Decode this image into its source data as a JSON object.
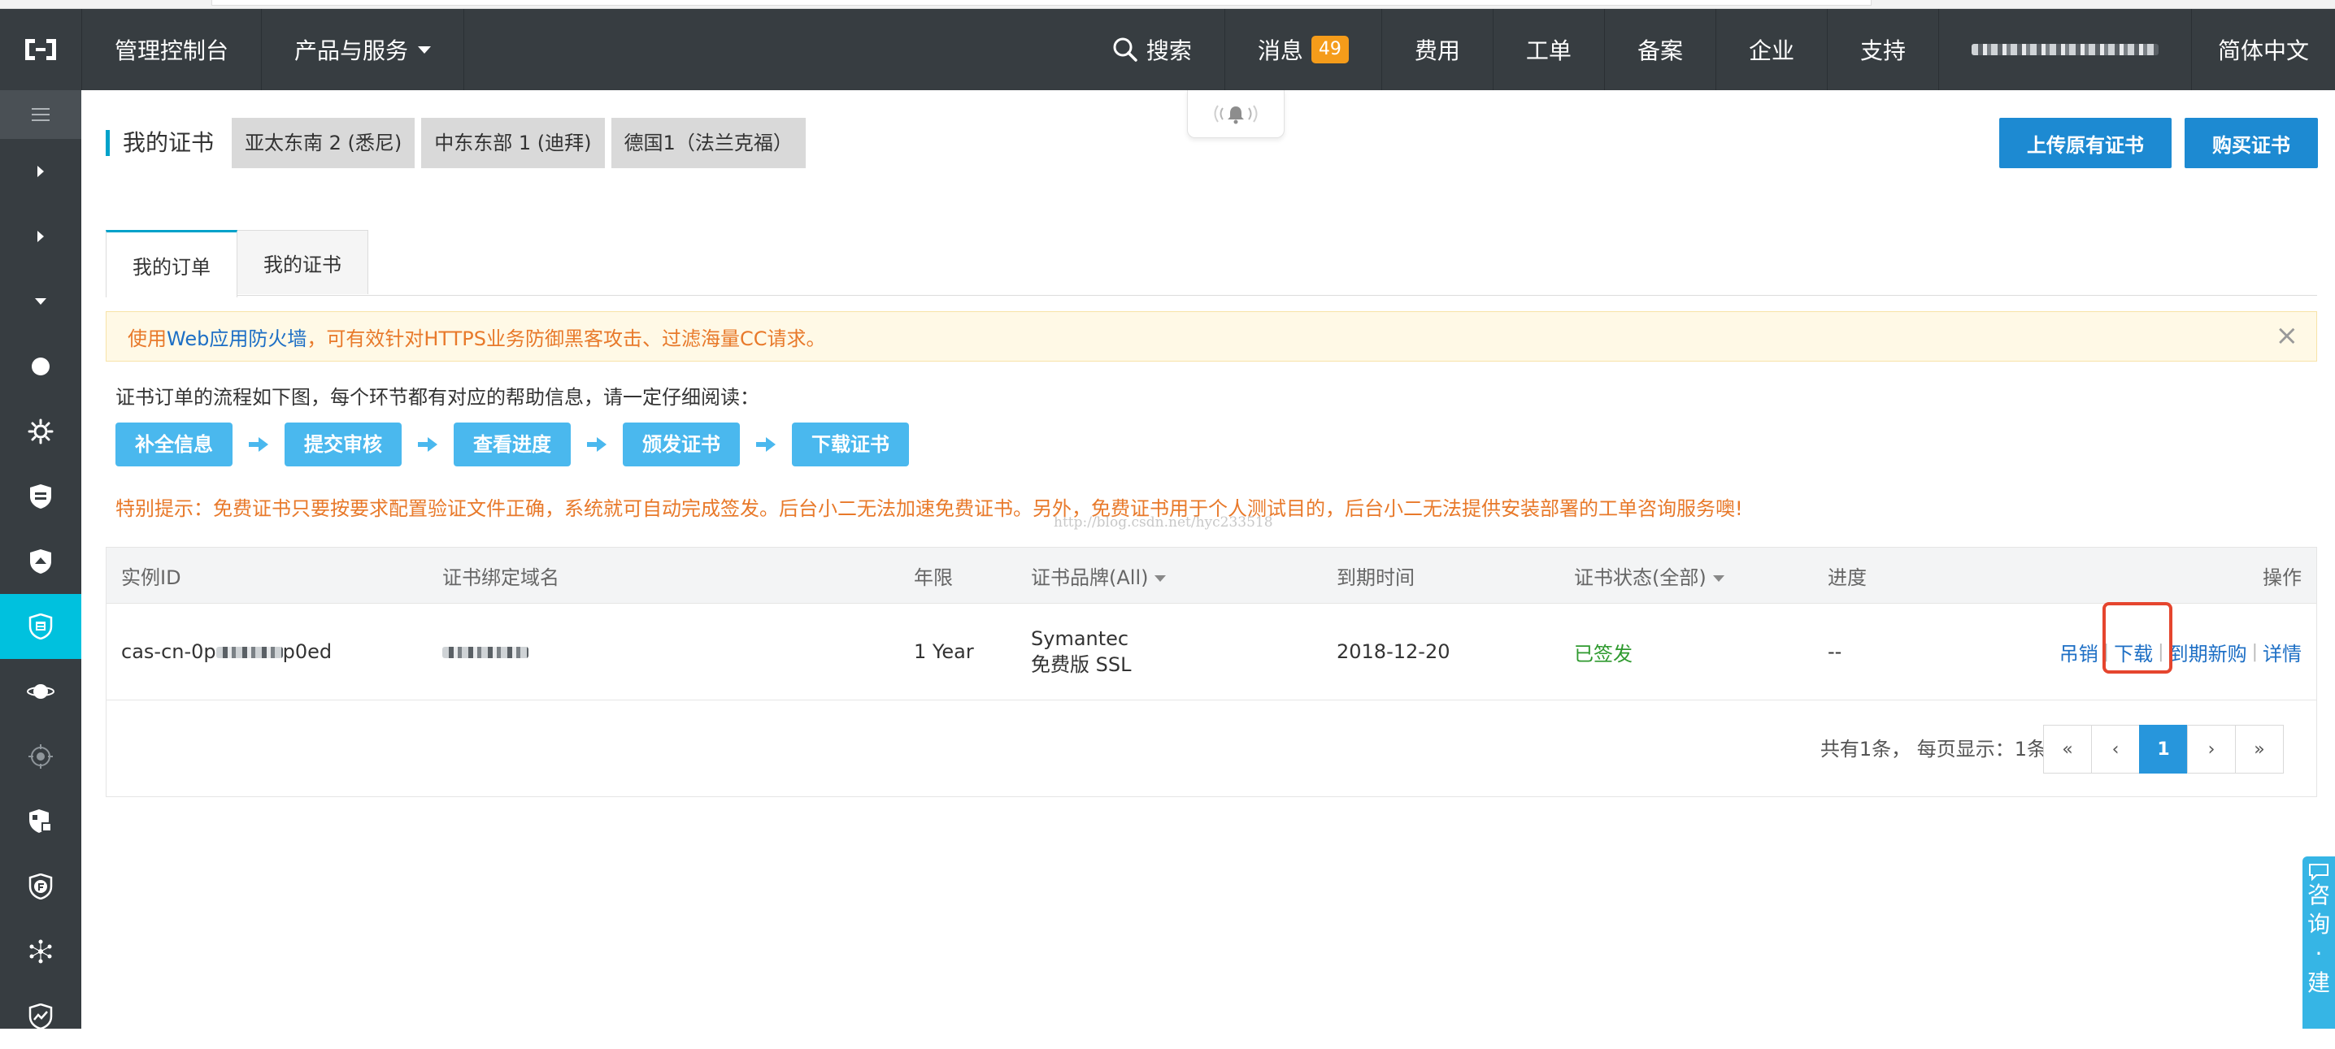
{
  "topnav": {
    "console": "管理控制台",
    "products": "产品与服务",
    "search": "搜索",
    "messages": "消息",
    "messages_count": "49",
    "billing": "费用",
    "ticket": "工单",
    "beian": "备案",
    "enterprise": "企业",
    "support": "支持",
    "language": "简体中文"
  },
  "sidebar": {
    "icons": [
      "menu-icon",
      "chevron-right-icon",
      "chevron-right-icon",
      "chevron-down-icon",
      "dot-icon",
      "gear-icon",
      "shield-icon",
      "shield-icon",
      "certificate-icon",
      "planet-icon",
      "target-icon",
      "shield-lock-icon",
      "shield-f-icon",
      "network-icon",
      "chart-shield-icon"
    ],
    "active_index": 8
  },
  "header": {
    "title": "我的证书",
    "regions": [
      "亚太东南 2 (悉尼)",
      "中东东部 1 (迪拜)",
      "德国1（法兰克福）"
    ],
    "upload_btn": "上传原有证书",
    "buy_btn": "购买证书"
  },
  "tabs": [
    "我的订单",
    "我的证书"
  ],
  "alert": {
    "prefix": "使用",
    "link": "Web应用防火墙",
    "suffix": "，可有效针对HTTPS业务防御黑客攻击、过滤海量CC请求。",
    "close": "×"
  },
  "flow": {
    "intro": "证书订单的流程如下图，每个环节都有对应的帮助信息，请一定仔细阅读：",
    "steps": [
      "补全信息",
      "提交审核",
      "查看进度",
      "颁发证书",
      "下载证书"
    ]
  },
  "notice": "特别提示：免费证书只要按要求配置验证文件正确，系统就可自动完成签发。后台小二无法加速免费证书。另外，免费证书用于个人测试目的，后台小二无法提供安装部署的工单咨询服务噢!",
  "watermark": "http://blog.csdn.net/hyc233518",
  "table": {
    "headers": {
      "id": "实例ID",
      "domain": "证书绑定域名",
      "term": "年限",
      "brand": "证书品牌(All)",
      "expire": "到期时间",
      "status": "证书状态(全部)",
      "progress": "进度",
      "ops": "操作"
    },
    "rows": [
      {
        "id_prefix": "cas-cn-0p",
        "id_suffix": "p0ed",
        "term": "1 Year",
        "brand_line1": "Symantec",
        "brand_line2": "免费版 SSL",
        "expire": "2018-12-20",
        "status": "已签发",
        "progress": "--",
        "ops": [
          "吊销",
          "下载",
          "到期新购",
          "详情"
        ]
      }
    ],
    "pager": {
      "info": "共有1条， 每页显示：1条",
      "first": "«",
      "prev": "‹",
      "page": "1",
      "next": "›",
      "last": "»"
    }
  },
  "consult": [
    "咨",
    "询",
    "·",
    "建"
  ],
  "colors": {
    "topbar": "#373d41",
    "accent": "#00c1de",
    "primary_button": "#1d8ad2",
    "step_button": "#4ab8ee",
    "warning_text": "#e8792a",
    "success_text": "#2f9a2f",
    "highlight_box": "#e5452e"
  }
}
